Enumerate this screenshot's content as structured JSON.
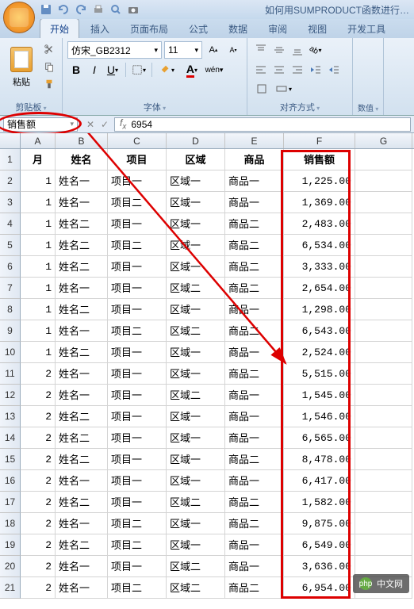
{
  "window_title": "如何用SUMPRODUCT函数进行…",
  "qat": [
    "save-icon",
    "undo-icon",
    "redo-icon",
    "print-icon",
    "preview-icon",
    "spell-icon"
  ],
  "tabs": [
    {
      "label": "开始",
      "active": true
    },
    {
      "label": "插入",
      "active": false
    },
    {
      "label": "页面布局",
      "active": false
    },
    {
      "label": "公式",
      "active": false
    },
    {
      "label": "数据",
      "active": false
    },
    {
      "label": "审阅",
      "active": false
    },
    {
      "label": "视图",
      "active": false
    },
    {
      "label": "开发工具",
      "active": false
    }
  ],
  "ribbon": {
    "clipboard": {
      "label": "剪贴板",
      "paste": "粘贴"
    },
    "font": {
      "label": "字体",
      "family": "仿宋_GB2312",
      "size": "11",
      "buttons": {
        "bold": "B",
        "italic": "I",
        "underline": "U"
      }
    },
    "align": {
      "label": "对齐方式",
      "merge": "合并"
    },
    "number": {
      "label": "数值"
    }
  },
  "namebox": "销售额",
  "formula": "6954",
  "columns": [
    "A",
    "B",
    "C",
    "D",
    "E",
    "F",
    "G"
  ],
  "headers": {
    "A": "月",
    "B": "姓名",
    "C": "项目",
    "D": "区域",
    "E": "商品",
    "F": "销售额"
  },
  "rows": [
    {
      "n": 2,
      "A": "1",
      "B": "姓名一",
      "C": "项目一",
      "D": "区域一",
      "E": "商品一",
      "F": "1,225.00"
    },
    {
      "n": 3,
      "A": "1",
      "B": "姓名一",
      "C": "项目二",
      "D": "区域一",
      "E": "商品一",
      "F": "1,369.00"
    },
    {
      "n": 4,
      "A": "1",
      "B": "姓名二",
      "C": "项目一",
      "D": "区域一",
      "E": "商品二",
      "F": "2,483.00"
    },
    {
      "n": 5,
      "A": "1",
      "B": "姓名二",
      "C": "项目二",
      "D": "区域一",
      "E": "商品二",
      "F": "6,534.00"
    },
    {
      "n": 6,
      "A": "1",
      "B": "姓名二",
      "C": "项目一",
      "D": "区域一",
      "E": "商品二",
      "F": "3,333.00"
    },
    {
      "n": 7,
      "A": "1",
      "B": "姓名一",
      "C": "项目一",
      "D": "区域二",
      "E": "商品二",
      "F": "2,654.00"
    },
    {
      "n": 8,
      "A": "1",
      "B": "姓名二",
      "C": "项目一",
      "D": "区域一",
      "E": "商品一",
      "F": "1,298.00"
    },
    {
      "n": 9,
      "A": "1",
      "B": "姓名一",
      "C": "项目二",
      "D": "区域二",
      "E": "商品二",
      "F": "6,543.00"
    },
    {
      "n": 10,
      "A": "1",
      "B": "姓名二",
      "C": "项目一",
      "D": "区域一",
      "E": "商品一",
      "F": "2,524.00"
    },
    {
      "n": 11,
      "A": "2",
      "B": "姓名一",
      "C": "项目一",
      "D": "区域一",
      "E": "商品二",
      "F": "5,515.00"
    },
    {
      "n": 12,
      "A": "2",
      "B": "姓名一",
      "C": "项目一",
      "D": "区域二",
      "E": "商品一",
      "F": "1,545.00"
    },
    {
      "n": 13,
      "A": "2",
      "B": "姓名二",
      "C": "项目一",
      "D": "区域一",
      "E": "商品一",
      "F": "1,546.00"
    },
    {
      "n": 14,
      "A": "2",
      "B": "姓名二",
      "C": "项目一",
      "D": "区域一",
      "E": "商品一",
      "F": "6,565.00"
    },
    {
      "n": 15,
      "A": "2",
      "B": "姓名二",
      "C": "项目一",
      "D": "区域一",
      "E": "商品二",
      "F": "8,478.00"
    },
    {
      "n": 16,
      "A": "2",
      "B": "姓名一",
      "C": "项目一",
      "D": "区域一",
      "E": "商品一",
      "F": "6,417.00"
    },
    {
      "n": 17,
      "A": "2",
      "B": "姓名二",
      "C": "项目一",
      "D": "区域二",
      "E": "商品二",
      "F": "1,582.00"
    },
    {
      "n": 18,
      "A": "2",
      "B": "姓名一",
      "C": "项目二",
      "D": "区域一",
      "E": "商品二",
      "F": "9,875.00"
    },
    {
      "n": 19,
      "A": "2",
      "B": "姓名二",
      "C": "项目二",
      "D": "区域一",
      "E": "商品一",
      "F": "6,549.00"
    },
    {
      "n": 20,
      "A": "2",
      "B": "姓名一",
      "C": "项目一",
      "D": "区域二",
      "E": "商品一",
      "F": "3,636.00"
    },
    {
      "n": 21,
      "A": "2",
      "B": "姓名一",
      "C": "项目二",
      "D": "区域二",
      "E": "商品二",
      "F": "6,954.00"
    }
  ],
  "watermark": {
    "logo": "php",
    "text": "中文网"
  }
}
